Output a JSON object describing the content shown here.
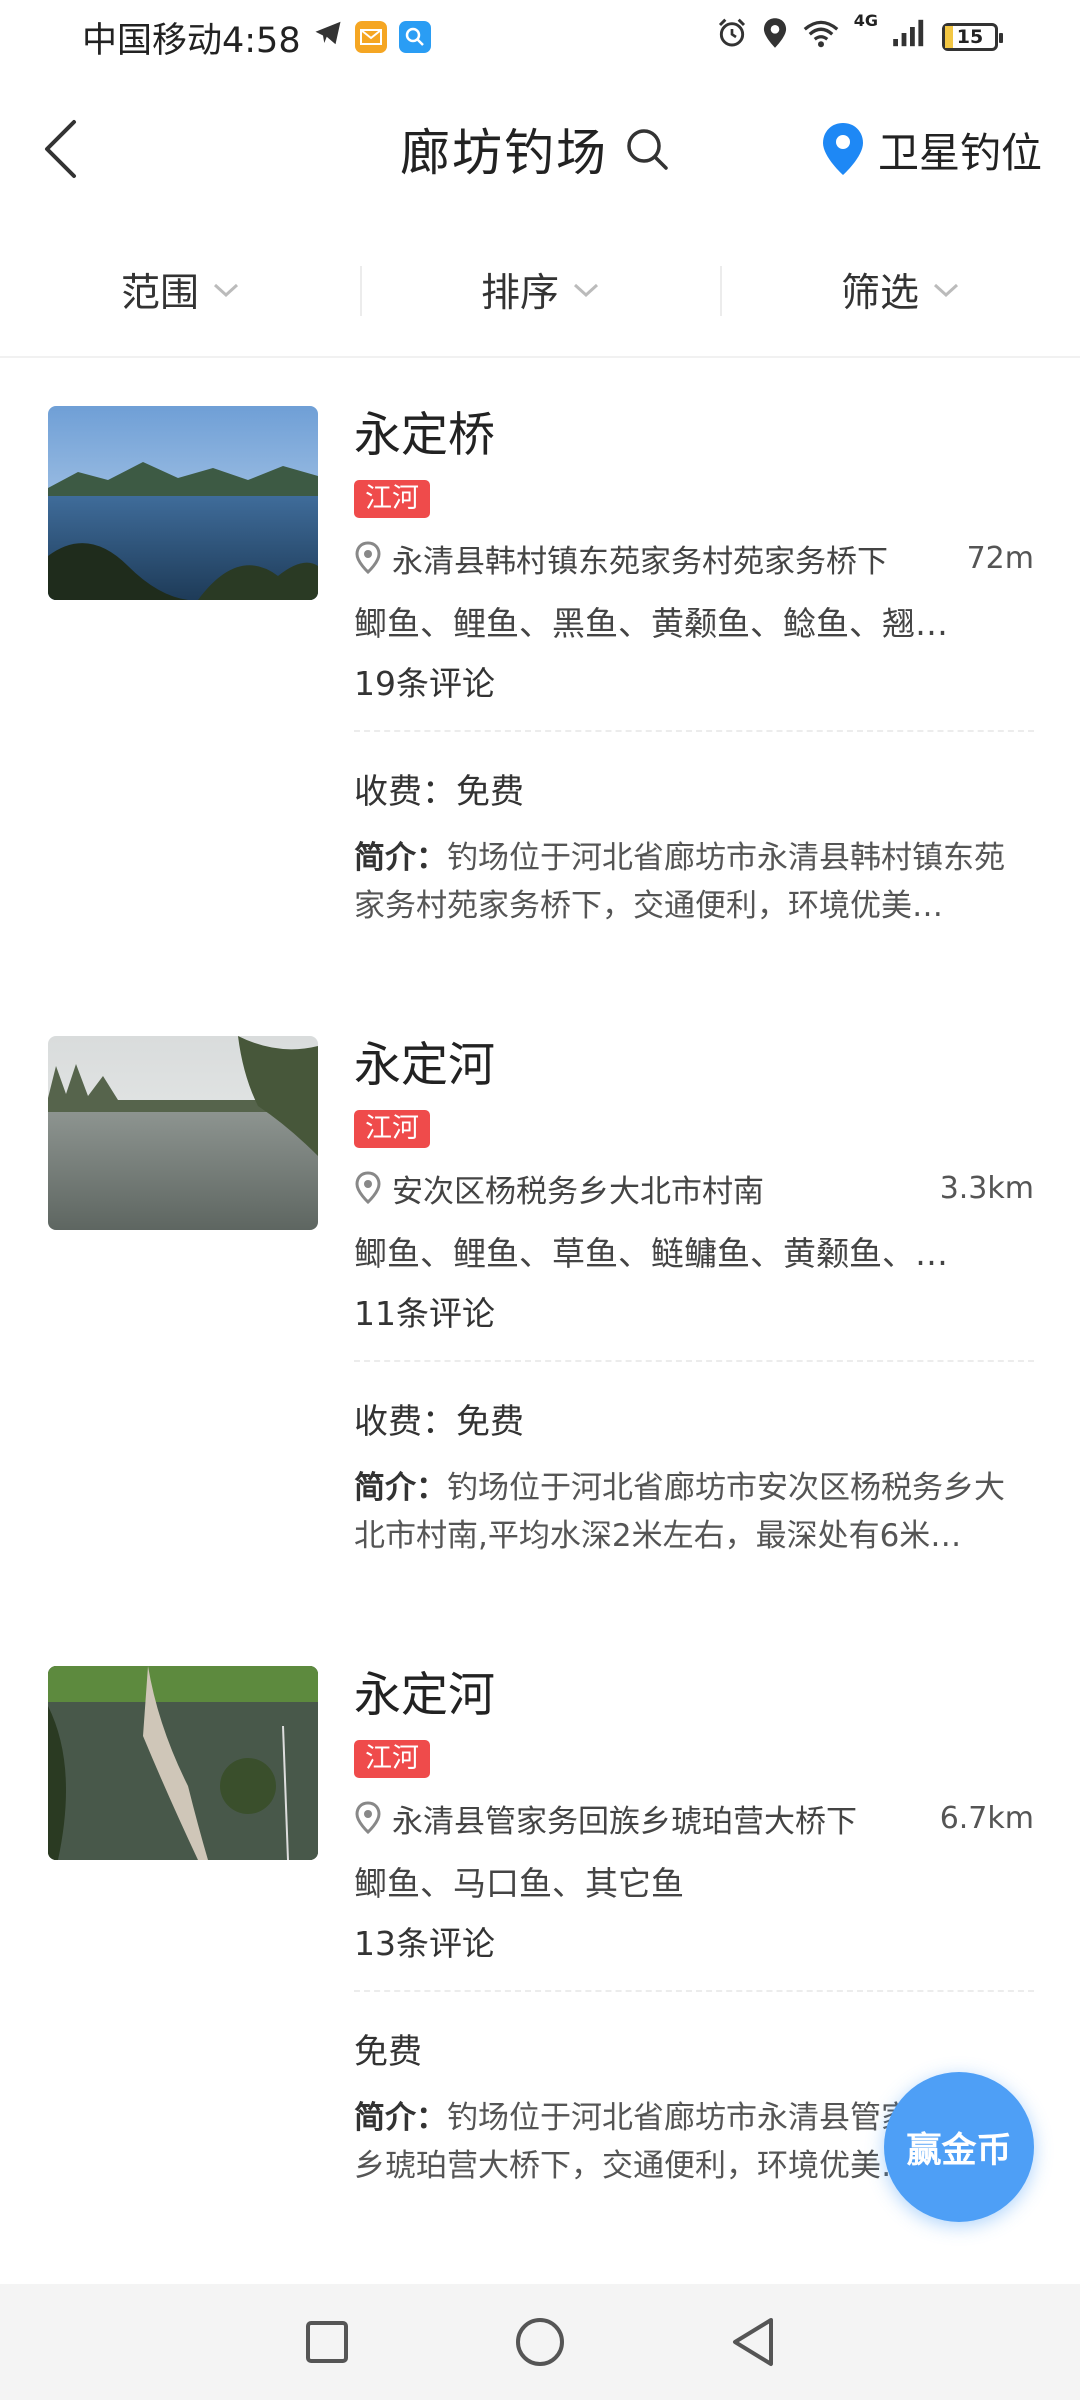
{
  "status_bar": {
    "carrier_time": "中国移动4:58",
    "network": "4G",
    "battery": "15",
    "battery_percent": 15,
    "icons": [
      "telegram-icon",
      "mail-icon",
      "search-app-icon",
      "alarm-icon",
      "location-icon",
      "wifi-icon",
      "signal-icon",
      "battery-icon"
    ]
  },
  "header": {
    "title": "廊坊钓场",
    "satellite_label": "卫星钓位"
  },
  "filters": [
    {
      "label": "范围"
    },
    {
      "label": "排序"
    },
    {
      "label": "筛选"
    }
  ],
  "spots": [
    {
      "name": "永定桥",
      "tag": "江河",
      "address": "永清县韩村镇东苑家务村苑家务桥下",
      "distance": "72m",
      "fish": "鲫鱼、鲤鱼、黑鱼、黄颡鱼、鲶鱼、翘…",
      "reviews": "19条评论",
      "fee": "收费：免费",
      "desc_label": "简介：",
      "desc": "钓场位于河北省廊坊市永清县韩村镇东苑家务村苑家务桥下，交通便利，环境优美…"
    },
    {
      "name": "永定河",
      "tag": "江河",
      "address": "安次区杨税务乡大北市村南",
      "distance": "3.3km",
      "fish": "鲫鱼、鲤鱼、草鱼、鲢鳙鱼、黄颡鱼、…",
      "reviews": "11条评论",
      "fee": "收费：免费",
      "desc_label": "简介：",
      "desc": "钓场位于河北省廊坊市安次区杨税务乡大北市村南,平均水深2米左右，最深处有6米…"
    },
    {
      "name": "永定河",
      "tag": "江河",
      "address": "永清县管家务回族乡琥珀营大桥下",
      "distance": "6.7km",
      "fish": "鲫鱼、马口鱼、其它鱼",
      "reviews": "13条评论",
      "fee": "免费",
      "desc_label": "简介：",
      "desc": "钓场位于河北省廊坊市永清县管家务回族乡琥珀营大桥下，交通便利，环境优美…"
    }
  ],
  "coin_button": "赢金币",
  "colors": {
    "tag_red": "#ef4b4b",
    "accent_blue": "#4e9ff6",
    "pin_blue": "#1e88f5"
  }
}
